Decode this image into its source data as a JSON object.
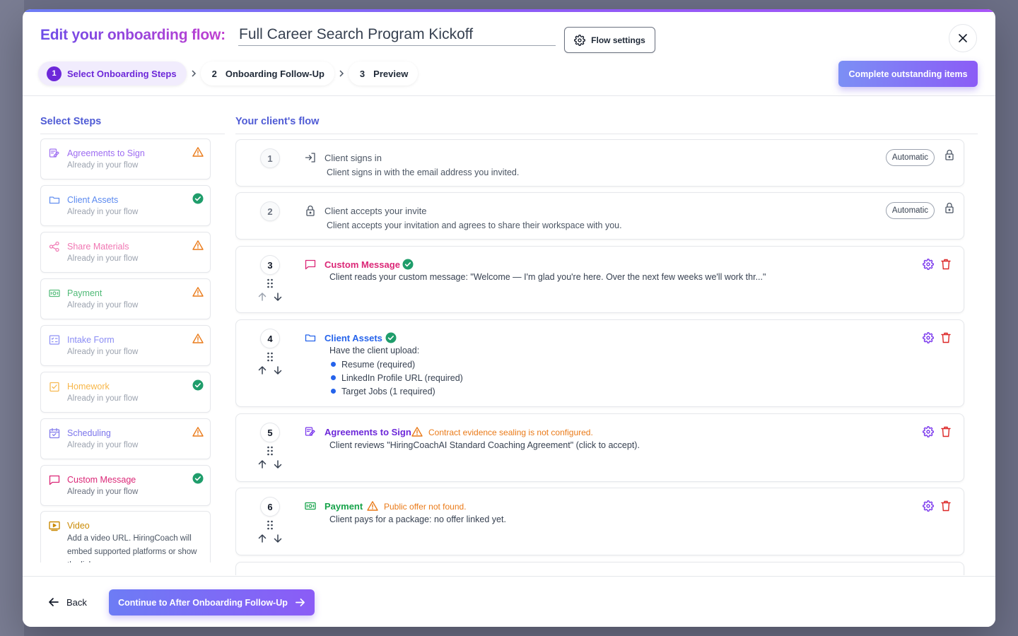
{
  "colors": {
    "accent": "#6d28d9",
    "heading_blue": "#4f5bd5",
    "success": "#1f9d6b",
    "warning": "#ea7a18",
    "danger": "#dc2626",
    "agreements": "#7c3aed",
    "assets": "#2563eb",
    "share": "#ec4899",
    "payment": "#16a34a",
    "intake": "#6366f1",
    "homework": "#f59e0b",
    "scheduling": "#4f46e5",
    "custom_message": "#db2777",
    "video": "#ca8a04"
  },
  "header": {
    "title_prefix": "Edit your onboarding flow:",
    "flow_name": "Full Career Search Program Kickoff",
    "flow_settings_label": "Flow settings",
    "close_icon": "close-icon",
    "complete_label": "Complete outstanding items"
  },
  "stepper": [
    {
      "num": "1",
      "label": "Select Onboarding Steps",
      "active": true
    },
    {
      "num": "2",
      "label": "Onboarding Follow-Up",
      "active": false
    },
    {
      "num": "3",
      "label": "Preview",
      "active": false
    }
  ],
  "select_steps": {
    "heading": "Select Steps",
    "items": [
      {
        "title": "Agreements to Sign",
        "sub": "Already in your flow",
        "icon": "signature-icon",
        "status": "warning"
      },
      {
        "title": "Client Assets",
        "sub": "Already in your flow",
        "icon": "folder-icon",
        "status": "success"
      },
      {
        "title": "Share Materials",
        "sub": "Already in your flow",
        "icon": "share-icon",
        "status": "warning"
      },
      {
        "title": "Payment",
        "sub": "Already in your flow",
        "icon": "money-icon",
        "status": "warning"
      },
      {
        "title": "Intake Form",
        "sub": "Already in your flow",
        "icon": "form-icon",
        "status": "warning"
      },
      {
        "title": "Homework",
        "sub": "Already in your flow",
        "icon": "checkbox-icon",
        "status": "success"
      },
      {
        "title": "Scheduling",
        "sub": "Already in your flow",
        "icon": "calendar-icon",
        "status": "warning"
      },
      {
        "title": "Custom Message",
        "sub": "Already in your flow",
        "icon": "message-icon",
        "status": "success"
      },
      {
        "title": "Video",
        "desc": "Add a video URL. HiringCoach will embed supported platforms or show the link.",
        "icon": "video-icon"
      }
    ]
  },
  "flow": {
    "heading": "Your client's flow",
    "automatic_label": "Automatic",
    "steps": [
      {
        "num": "1",
        "title": "Client signs in",
        "desc": "Client signs in with the email address you invited.",
        "icon": "sign-in-icon"
      },
      {
        "num": "2",
        "title": "Client accepts your invite",
        "desc": "Client accepts your invitation and agrees to share their workspace with you.",
        "icon": "lock-icon"
      },
      {
        "num": "3",
        "title": "Custom Message",
        "desc": "Client reads your custom message: \"Welcome — I'm glad you're here. Over the next few weeks we'll work thr...\"",
        "icon": "message-icon"
      },
      {
        "num": "4",
        "title": "Client Assets",
        "intro": "Have the client upload:",
        "items": [
          "Resume (required)",
          "LinkedIn Profile URL (required)",
          "Target Jobs (1 required)"
        ],
        "icon": "folder-icon"
      },
      {
        "num": "5",
        "title": "Agreements to Sign",
        "warning": "Contract evidence sealing is not configured.",
        "desc": "Client reviews \"HiringCoachAI Standard Coaching Agreement\" (click to accept).",
        "icon": "signature-icon"
      },
      {
        "num": "6",
        "title": "Payment",
        "warning": "Public offer not found.",
        "desc": "Client pays for a package: no offer linked yet.",
        "icon": "money-icon"
      }
    ]
  },
  "footer": {
    "back_label": "Back",
    "continue_label": "Continue to After Onboarding Follow-Up"
  }
}
